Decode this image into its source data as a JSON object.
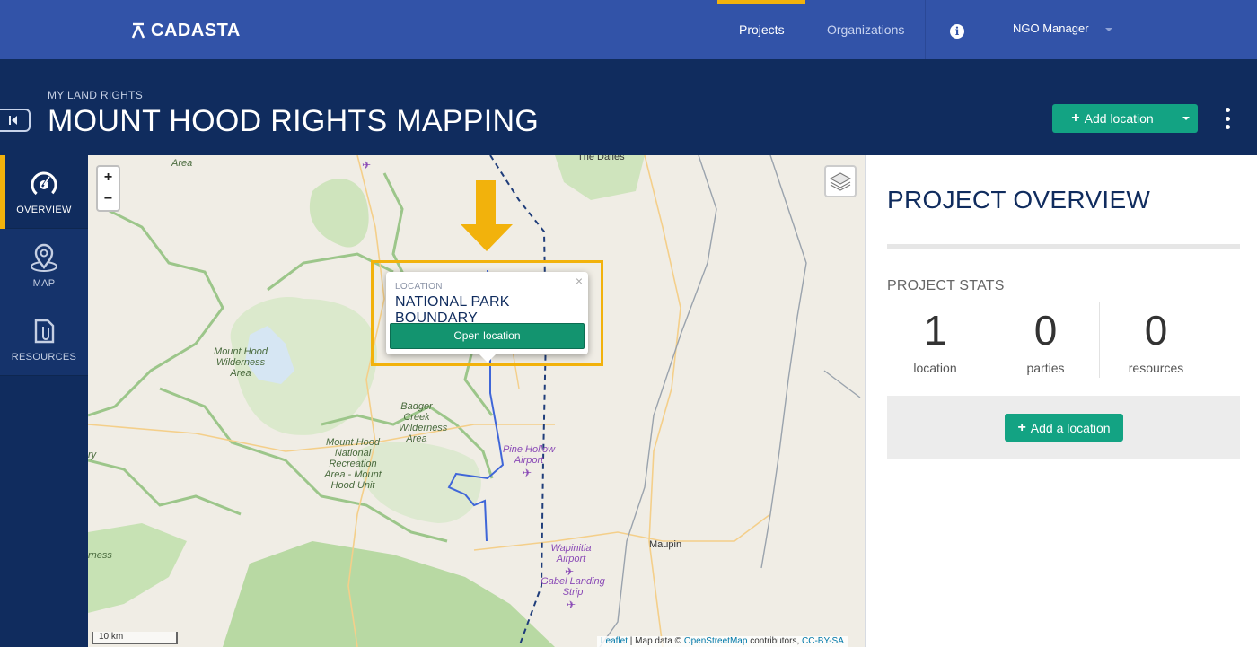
{
  "app": {
    "logo_text": "CADASTA"
  },
  "nav": {
    "links": [
      {
        "label": "Projects",
        "active": true
      },
      {
        "label": "Organizations",
        "active": false
      }
    ],
    "info_icon": "info-icon",
    "user": "NGO Manager"
  },
  "header": {
    "org": "MY LAND RIGHTS",
    "title": "MOUNT HOOD RIGHTS MAPPING",
    "add_location": "Add location"
  },
  "sidebar": {
    "items": [
      {
        "label": "OVERVIEW",
        "icon": "dashboard-icon",
        "active": true
      },
      {
        "label": "MAP",
        "icon": "map-pin-icon",
        "active": false
      },
      {
        "label": "RESOURCES",
        "icon": "file-clip-icon",
        "active": false
      }
    ]
  },
  "map": {
    "zoom_in": "+",
    "zoom_out": "−",
    "labels": {
      "area_top": "Area",
      "the_dalles": "The Dalles",
      "mount_hood_wilderness": "Mount Hood Wilderness Area",
      "badger_creek": "Badger Creek Wilderness Area",
      "mount_hood_nra": "Mount Hood National Recreation Area - Mount Hood Unit",
      "pine_hollow": "Pine Hollow Airport",
      "wapinitia": "Wapinitia Airport",
      "gabel": "Gabel Landing Strip",
      "maupin": "Maupin",
      "ry": "ry",
      "rness": "rness"
    },
    "scale": "10 km",
    "attribution": {
      "leaflet": "Leaflet",
      "text": " | Map data © ",
      "osm": "OpenStreetMap",
      "contrib": " contributors, ",
      "license": "CC-BY-SA"
    },
    "popup": {
      "label": "LOCATION",
      "title": "NATIONAL PARK BOUNDARY",
      "button": "Open location",
      "close": "×"
    },
    "colors": {
      "highlight": "#f2b20c",
      "boundary": "#3f66d8"
    }
  },
  "overview": {
    "title": "PROJECT OVERVIEW",
    "stats_label": "PROJECT STATS",
    "stats": [
      {
        "value": "1",
        "label": "location"
      },
      {
        "value": "0",
        "label": "parties"
      },
      {
        "value": "0",
        "label": "resources"
      }
    ],
    "add_button": "Add a location"
  },
  "colors": {
    "nav": "#3253a8",
    "header": "#102c5e",
    "accent": "#f2b20c",
    "primary_button": "#13a383"
  }
}
